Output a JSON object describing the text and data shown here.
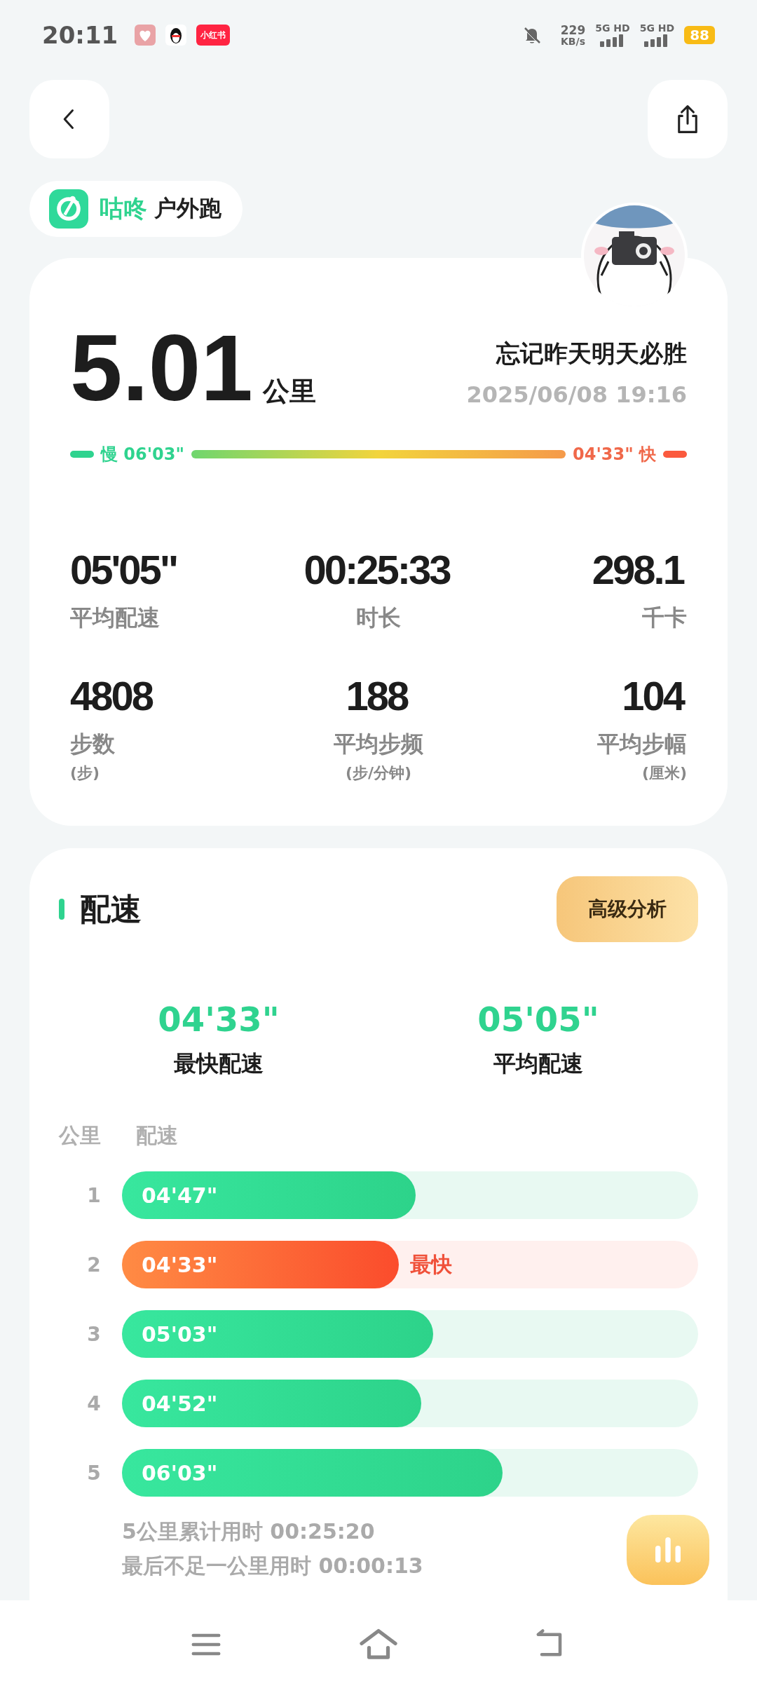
{
  "status_bar": {
    "time": "20:11",
    "app_badge": "小红书",
    "speed": "229",
    "speed_unit": "KB/s",
    "networks": [
      "5G HD",
      "5G HD"
    ],
    "battery": "88"
  },
  "header": {
    "brand": "咕咚",
    "activity": "户外跑"
  },
  "summary": {
    "distance": "5.01",
    "distance_unit": "公里",
    "user_name": "忘记昨天明天必胜",
    "datetime": "2025/06/08 19:16",
    "slow_label": "慢",
    "slow_pace": "06'03\"",
    "fast_pace": "04'33\"",
    "fast_label": "快"
  },
  "stats": [
    {
      "value": "05'05\"",
      "label": "平均配速"
    },
    {
      "value": "00:25:33",
      "label": "时长"
    },
    {
      "value": "298.1",
      "label": "千卡"
    },
    {
      "value": "4808",
      "label": "步数",
      "unit": "(步)"
    },
    {
      "value": "188",
      "label": "平均步频",
      "unit": "(步/分钟)"
    },
    {
      "value": "104",
      "label": "平均步幅",
      "unit": "(厘米)"
    }
  ],
  "pace_section": {
    "title": "配速",
    "advanced_button": "高级分析",
    "highlights": [
      {
        "value": "04'33\"",
        "label": "最快配速"
      },
      {
        "value": "05'05\"",
        "label": "平均配速"
      }
    ],
    "columns": [
      "公里",
      "配速"
    ],
    "splits": [
      {
        "km": "1",
        "pace": "04'47\"",
        "level": 0.51,
        "kind": "normal"
      },
      {
        "km": "2",
        "pace": "04'33\"",
        "level": 0.48,
        "kind": "fastest",
        "tag": "最快"
      },
      {
        "km": "3",
        "pace": "05'03\"",
        "level": 0.54,
        "kind": "normal"
      },
      {
        "km": "4",
        "pace": "04'52\"",
        "level": 0.52,
        "kind": "normal"
      },
      {
        "km": "5",
        "pace": "06'03\"",
        "level": 0.66,
        "kind": "normal"
      }
    ],
    "notes": [
      "5公里累计用时 00:25:20",
      "最后不足一公里用时 00:00:13"
    ]
  }
}
